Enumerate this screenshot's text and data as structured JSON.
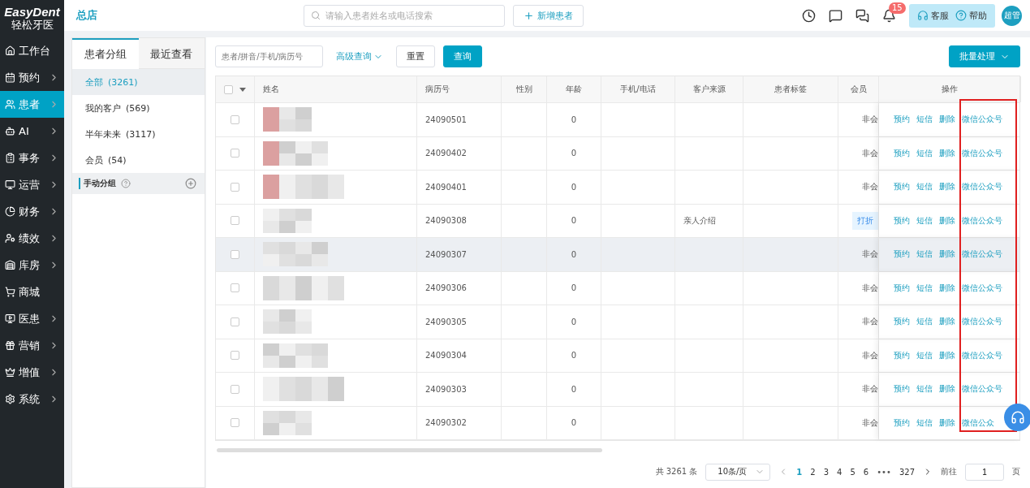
{
  "logo": {
    "brand": "EasyDent",
    "subtitle": "轻松牙医"
  },
  "sidebar": {
    "items": [
      {
        "label": "工作台",
        "has_submenu": false,
        "selected": false
      },
      {
        "label": "预约",
        "has_submenu": true,
        "selected": false
      },
      {
        "label": "患者",
        "has_submenu": true,
        "selected": true
      },
      {
        "label": "AI",
        "has_submenu": true,
        "selected": false
      },
      {
        "label": "事务",
        "has_submenu": true,
        "selected": false
      },
      {
        "label": "运营",
        "has_submenu": true,
        "selected": false
      },
      {
        "label": "财务",
        "has_submenu": true,
        "selected": false
      },
      {
        "label": "绩效",
        "has_submenu": true,
        "selected": false
      },
      {
        "label": "库房",
        "has_submenu": true,
        "selected": false
      },
      {
        "label": "商城",
        "has_submenu": false,
        "selected": false
      },
      {
        "label": "医患",
        "has_submenu": true,
        "selected": false
      },
      {
        "label": "营销",
        "has_submenu": true,
        "selected": false
      },
      {
        "label": "增值",
        "has_submenu": true,
        "selected": false
      },
      {
        "label": "系统",
        "has_submenu": true,
        "selected": false
      }
    ]
  },
  "header": {
    "store": "总店",
    "search": {
      "placeholder": "请输入患者姓名或电话搜索"
    },
    "add_button": "新增患者",
    "notification_count": "15",
    "service_button": "客服",
    "help_button": "帮助",
    "avatar": "超管"
  },
  "group_panel": {
    "tabs": [
      {
        "label": "患者分组",
        "selected": true
      },
      {
        "label": "最近查看",
        "selected": false
      }
    ],
    "groups": [
      {
        "label": "全部",
        "count": "(3261)",
        "selected": true
      },
      {
        "label": "我的客户",
        "count": "(569)",
        "selected": false
      },
      {
        "label": "半年未来",
        "count": "(3117)",
        "selected": false
      },
      {
        "label": "会员",
        "count": "(54)",
        "selected": false
      }
    ],
    "manual_group": "手动分组"
  },
  "toolbar": {
    "search": {
      "placeholder": "患者/拼音/手机/病历号"
    },
    "advanced": "高级查询",
    "reset": "重置",
    "query": "查询",
    "batch": "批量处理"
  },
  "table": {
    "select_all_checked": false,
    "columns": [
      "姓名",
      "病历号",
      "性别",
      "年龄",
      "手机/电话",
      "客户来源",
      "患者标签",
      "会员",
      "操作"
    ],
    "rows": [
      {
        "checked": false,
        "highlighted": false,
        "record": "24090501",
        "age": "0",
        "member": "非会",
        "tagged": false,
        "actions": [
          "预约",
          "短信",
          "删除",
          "微信公众号"
        ]
      },
      {
        "checked": false,
        "highlighted": false,
        "record": "24090402",
        "age": "0",
        "member": "非会",
        "tagged": false,
        "actions": [
          "预约",
          "短信",
          "删除",
          "微信公众号"
        ]
      },
      {
        "checked": false,
        "highlighted": false,
        "record": "24090401",
        "age": "0",
        "member": "非会",
        "tagged": false,
        "actions": [
          "预约",
          "短信",
          "删除",
          "微信公众号"
        ]
      },
      {
        "checked": false,
        "highlighted": false,
        "record": "24090308",
        "age": "0",
        "source": "亲人介绍",
        "member": "打折",
        "tagged": true,
        "actions": [
          "预约",
          "短信",
          "删除",
          "微信公众号"
        ]
      },
      {
        "checked": false,
        "highlighted": true,
        "record": "24090307",
        "age": "0",
        "member": "非会",
        "tagged": false,
        "actions": [
          "预约",
          "短信",
          "删除",
          "微信公众号"
        ]
      },
      {
        "checked": false,
        "highlighted": false,
        "record": "24090306",
        "age": "0",
        "member": "非会",
        "tagged": false,
        "actions": [
          "预约",
          "短信",
          "删除",
          "微信公众号"
        ]
      },
      {
        "checked": false,
        "highlighted": false,
        "record": "24090305",
        "age": "0",
        "member": "非会",
        "tagged": false,
        "actions": [
          "预约",
          "短信",
          "删除",
          "微信公众号"
        ]
      },
      {
        "checked": false,
        "highlighted": false,
        "record": "24090304",
        "age": "0",
        "member": "非会",
        "tagged": false,
        "actions": [
          "预约",
          "短信",
          "删除",
          "微信公众号"
        ]
      },
      {
        "checked": false,
        "highlighted": false,
        "record": "24090303",
        "age": "0",
        "member": "非会",
        "tagged": false,
        "actions": [
          "预约",
          "短信",
          "删除",
          "微信公众号"
        ]
      },
      {
        "checked": false,
        "highlighted": false,
        "record": "24090302",
        "age": "0",
        "member": "非会",
        "tagged": false,
        "actions": [
          "预约",
          "短信",
          "删除",
          "微信公众"
        ]
      }
    ]
  },
  "pagination": {
    "total": "共 3261 条",
    "page_size": "10条/页",
    "pages": [
      {
        "label": "1",
        "selected": true
      },
      {
        "label": "2",
        "selected": false
      },
      {
        "label": "3",
        "selected": false
      },
      {
        "label": "4",
        "selected": false
      },
      {
        "label": "5",
        "selected": false
      },
      {
        "label": "6",
        "selected": false
      }
    ],
    "ellipsis": "•••",
    "last": "327",
    "goto": "前往",
    "goto_value": "1",
    "page_unit": "页"
  }
}
